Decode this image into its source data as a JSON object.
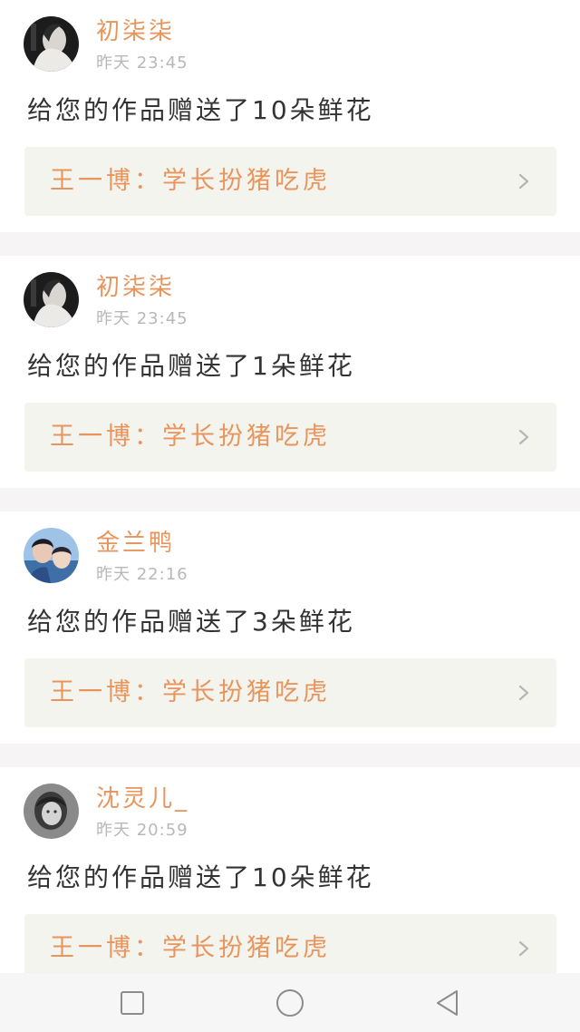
{
  "notifications": [
    {
      "username": "初柒柒",
      "timestamp": "昨天 23:45",
      "message": "给您的作品赠送了10朵鲜花",
      "work_title": "王一博：学长扮猪吃虎",
      "avatar_icon": "avatar-dark-portrait-icon"
    },
    {
      "username": "初柒柒",
      "timestamp": "昨天 23:45",
      "message": "给您的作品赠送了1朵鲜花",
      "work_title": "王一博：学长扮猪吃虎",
      "avatar_icon": "avatar-dark-portrait-icon"
    },
    {
      "username": "金兰鸭",
      "timestamp": "昨天 22:16",
      "message": "给您的作品赠送了3朵鲜花",
      "work_title": "王一博：学长扮猪吃虎",
      "avatar_icon": "avatar-two-people-icon"
    },
    {
      "username": "沈灵儿_",
      "timestamp": "昨天 20:59",
      "message": "给您的作品赠送了10朵鲜花",
      "work_title": "王一博：学长扮猪吃虎",
      "avatar_icon": "avatar-gray-portrait-icon"
    }
  ],
  "colors": {
    "accent": "#e8955d",
    "timestamp": "#b8b8b8",
    "message": "#333333",
    "link_background": "#f4f4ee",
    "separator": "#f6f4f5",
    "navbar": "#f6f6f6"
  },
  "navbar": {
    "recent_apps_icon": "square-icon",
    "home_icon": "circle-icon",
    "back_icon": "triangle-back-icon"
  }
}
